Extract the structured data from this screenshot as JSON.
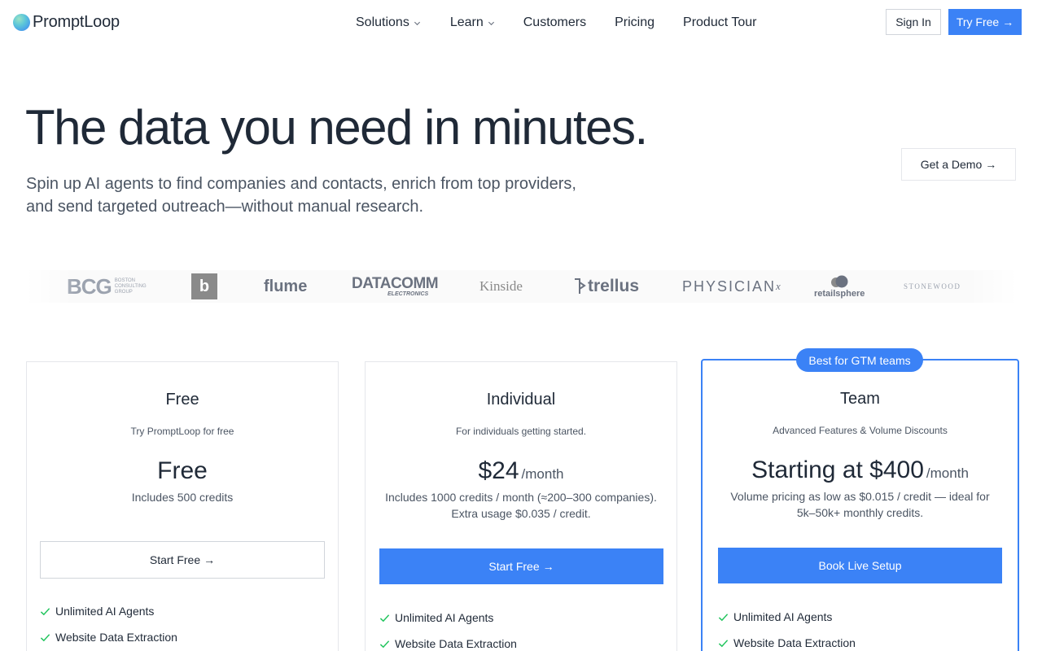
{
  "brand": {
    "name": "PromptLoop"
  },
  "nav": {
    "items": [
      {
        "label": "Solutions",
        "dropdown": true
      },
      {
        "label": "Learn",
        "dropdown": true
      },
      {
        "label": "Customers",
        "dropdown": false
      },
      {
        "label": "Pricing",
        "dropdown": false
      },
      {
        "label": "Product Tour",
        "dropdown": false
      }
    ],
    "sign_in": "Sign In",
    "try_free": "Try Free",
    "arrow": "→"
  },
  "hero": {
    "title": "The data you need in minutes.",
    "subtitle_line1": "Spin up AI agents to find companies and contacts, enrich from top providers,",
    "subtitle_line2": "and send targeted outreach—without manual research.",
    "demo_button": "Get a Demo"
  },
  "logos": {
    "bcg": {
      "mark": "BCG",
      "line1": "BOSTON",
      "line2": "CONSULTING",
      "line3": "GROUP"
    },
    "b": "b",
    "flume": "flume",
    "datacomm": {
      "mark": "DATACOMM",
      "sub": "ELECTRONICS"
    },
    "kinside": "Kinside",
    "trellus": "trellus",
    "physician": {
      "mark": "PHYSICIAN",
      "sup": "x"
    },
    "retailsphere": "retailsphere",
    "stonewood": "STONEWOOD"
  },
  "plans": {
    "free": {
      "title": "Free",
      "tagline": "Try PromptLoop for free",
      "price": "Free",
      "price_unit": "",
      "desc_line1": "Includes 500 credits",
      "desc_line2": "",
      "button": "Start Free",
      "features": [
        "Unlimited AI Agents",
        "Website Data Extraction"
      ]
    },
    "individual": {
      "title": "Individual",
      "tagline": "For individuals getting started.",
      "price": "$24",
      "price_unit": "/month",
      "desc_line1": "Includes 1000 credits / month (≈200–300 companies).",
      "desc_line2": "Extra usage $0.035 / credit.",
      "button": "Start Free",
      "features": [
        "Unlimited AI Agents",
        "Website Data Extraction"
      ]
    },
    "team": {
      "badge": "Best for GTM teams",
      "title": "Team",
      "tagline": "Advanced Features & Volume Discounts",
      "price": "Starting at $400",
      "price_unit": "/month",
      "desc_line1": "Volume pricing as low as $0.015 / credit — ideal for",
      "desc_line2": "5k–50k+ monthly credits.",
      "button": "Book Live Setup",
      "features": [
        "Unlimited AI Agents",
        "Website Data Extraction"
      ]
    }
  },
  "colors": {
    "accent": "#3b82f6",
    "check": "#22c55e",
    "text": "#1f2937",
    "muted": "#4b5563"
  },
  "icons": {
    "chevron": "chevron-down-icon",
    "arrow": "arrow-right-icon",
    "check": "check-icon"
  }
}
